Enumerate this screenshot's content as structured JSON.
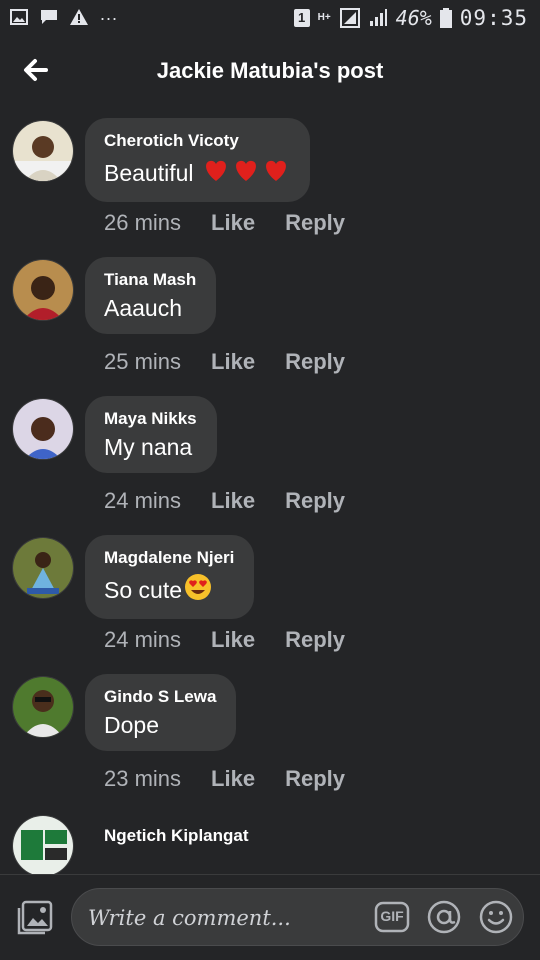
{
  "status_bar": {
    "battery": "46%",
    "time": "09:35",
    "sim": "1",
    "network": "H+"
  },
  "header": {
    "title": "Jackie Matubia's post"
  },
  "comments": [
    {
      "author": "Cherotich Vicoty",
      "text": "Beautiful",
      "emoji": "heart-icons",
      "time": "26 mins",
      "like": "Like",
      "reply": "Reply"
    },
    {
      "author": "Tiana Mash",
      "text": "Aaauch",
      "time": "25 mins",
      "like": "Like",
      "reply": "Reply"
    },
    {
      "author": "Maya Nikks",
      "text": "My nana",
      "time": "24 mins",
      "like": "Like",
      "reply": "Reply"
    },
    {
      "author": "Magdalene Njeri",
      "text": "So cute",
      "emoji": "heart-eyes-emoji",
      "time": "24 mins",
      "like": "Like",
      "reply": "Reply"
    },
    {
      "author": "Gindo S Lewa",
      "text": "Dope",
      "time": "23 mins",
      "like": "Like",
      "reply": "Reply"
    },
    {
      "author": "Ngetich Kiplangat"
    }
  ],
  "composer": {
    "placeholder": "Write a comment...",
    "gif_label": "GIF"
  }
}
